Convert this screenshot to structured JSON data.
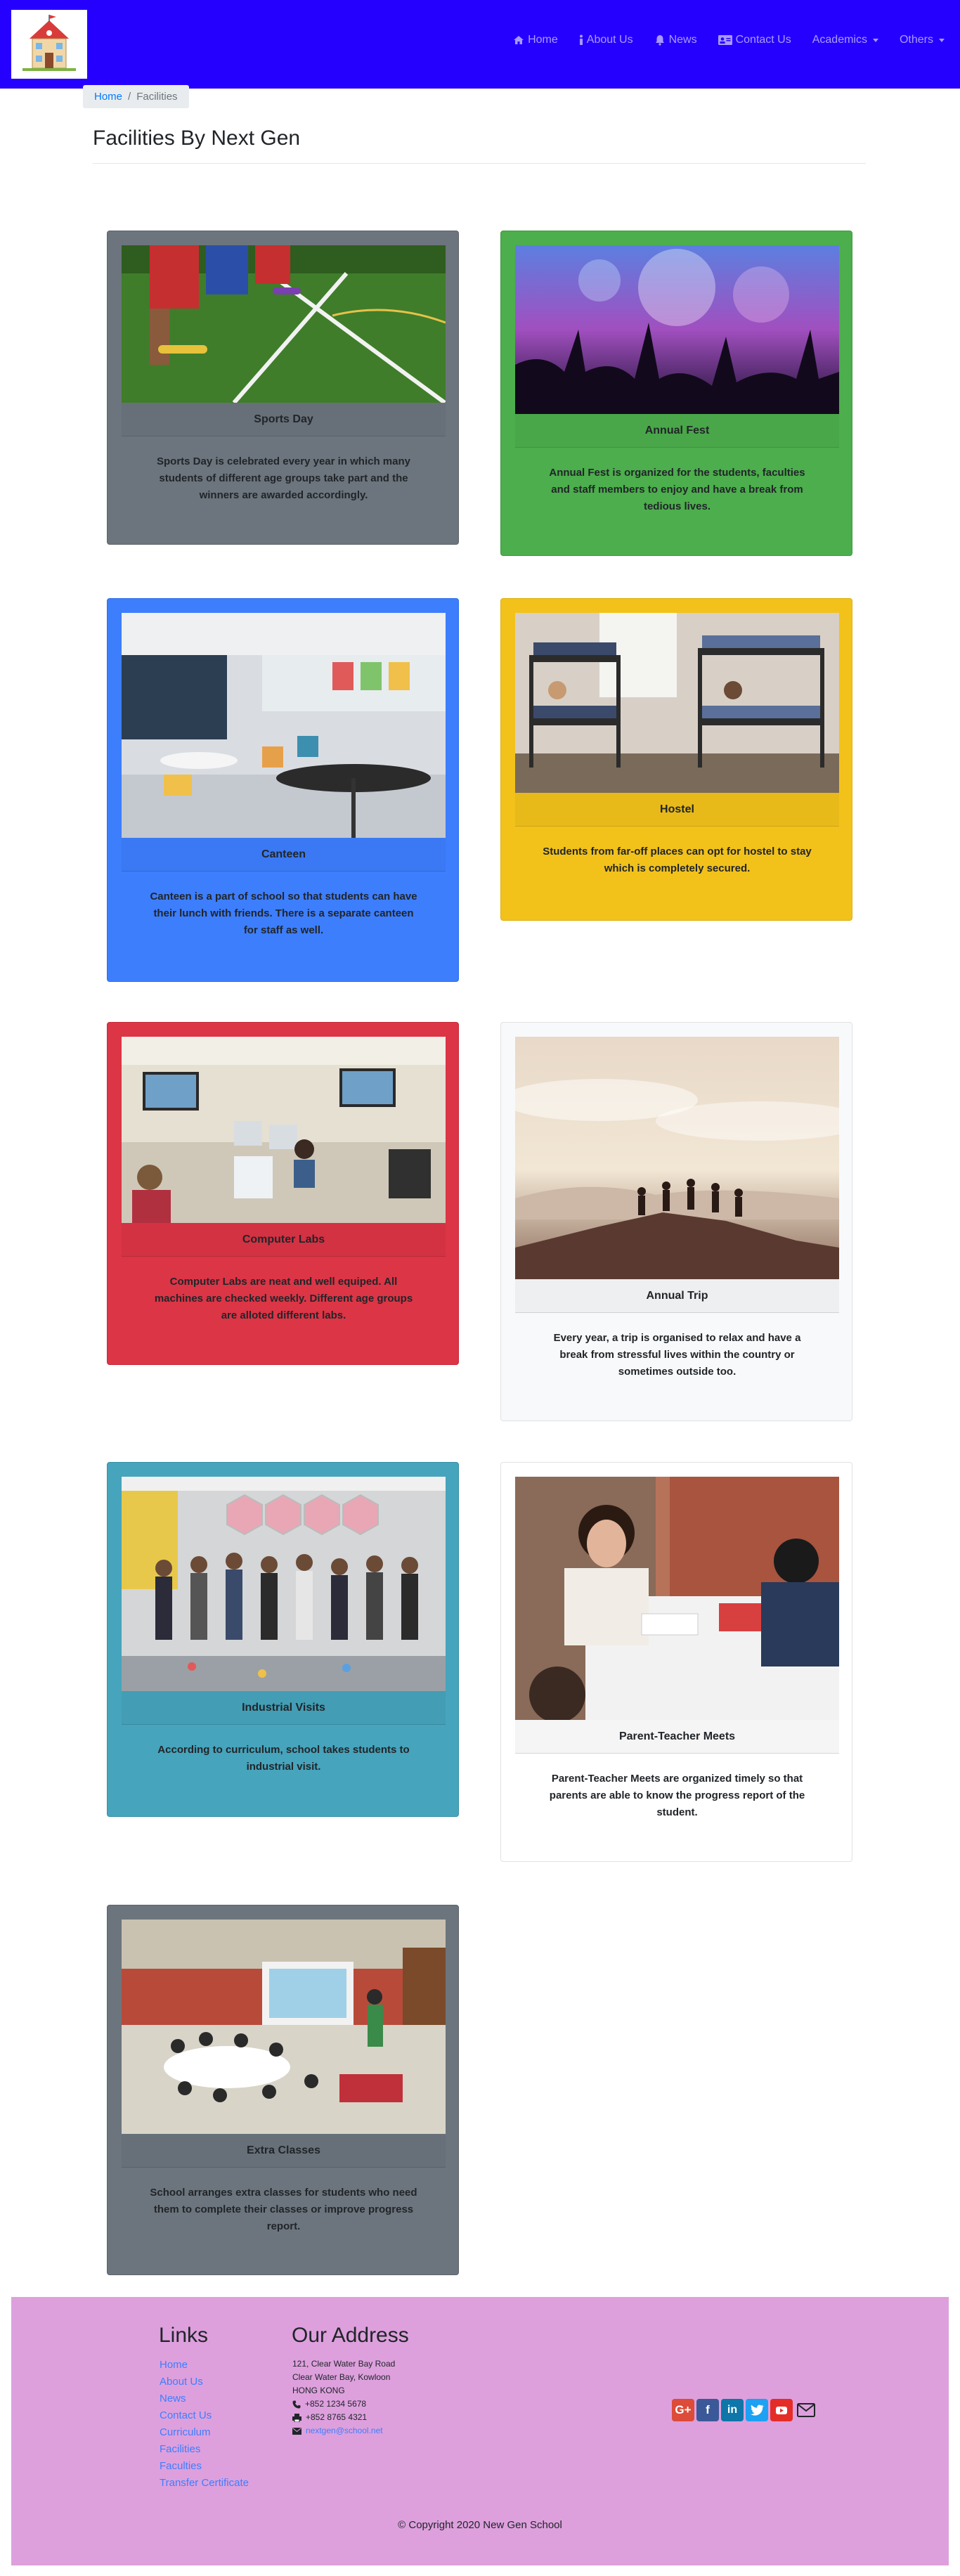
{
  "nav": {
    "items": [
      {
        "label": "Home",
        "icon": "home-icon"
      },
      {
        "label": "About Us",
        "icon": "info-icon"
      },
      {
        "label": "News",
        "icon": "bell-icon"
      },
      {
        "label": "Contact Us",
        "icon": "contact-card-icon"
      },
      {
        "label": "Academics",
        "dropdown": true
      },
      {
        "label": "Others",
        "dropdown": true
      }
    ]
  },
  "breadcrumb": {
    "home": "Home",
    "separator": "/",
    "current": "Facilities"
  },
  "page": {
    "title": "Facilities By Next Gen"
  },
  "cards": [
    {
      "title": "Sports Day",
      "text": "Sports Day is celebrated every year in which many students of different age groups take part and the winners are awarded accordingly.",
      "color": "#6c757d"
    },
    {
      "title": "Annual Fest",
      "text": "Annual Fest is organized for the students, faculties and staff members to enjoy and have a break from tedious lives.",
      "color": "#4cae4c"
    },
    {
      "title": "Canteen",
      "text": "Canteen is a part of school so that students can have their lunch with friends. There is a separate canteen for staff as well.",
      "color": "#3d7efd"
    },
    {
      "title": "Hostel",
      "text": "Students from far-off places can opt for hostel to stay which is completely secured.",
      "color": "#f2c21b"
    },
    {
      "title": "Computer Labs",
      "text": "Computer Labs are neat and well equiped. All machines are checked weekly. Different age groups are alloted different labs.",
      "color": "#dc3546"
    },
    {
      "title": "Annual Trip",
      "text": "Every year, a trip is organised to relax and have a break from stressful lives within the country or sometimes outside too.",
      "color": "#f8f9fa"
    },
    {
      "title": "Industrial Visits",
      "text": "According to curriculum, school takes students to industrial visit.",
      "color": "#46a4bc"
    },
    {
      "title": "Parent-Teacher Meets",
      "text": "Parent-Teacher Meets are organized timely so that parents are able to know the progress report of the student.",
      "color": "#ffffff"
    },
    {
      "title": "Extra Classes",
      "text": "School arranges extra classes for students who need them to complete their classes or improve progress report.",
      "color": "#6c757d"
    }
  ],
  "footer": {
    "links_title": "Links",
    "links": [
      "Home",
      "About Us",
      "News",
      "Contact Us",
      "Curriculum",
      "Facilities",
      "Faculties",
      "Transfer Certificate"
    ],
    "address_title": "Our Address",
    "address_lines": [
      "121, Clear Water Bay Road",
      "Clear Water Bay, Kowloon",
      "HONG KONG"
    ],
    "phone": "+852 1234 5678",
    "fax": "+852 8765 4321",
    "email": "nextgen@school.net",
    "copyright": "© Copyright 2020 New Gen School",
    "social_icons": [
      "google-plus-icon",
      "facebook-icon",
      "linkedin-icon",
      "twitter-icon",
      "youtube-icon",
      "mail-icon"
    ]
  }
}
